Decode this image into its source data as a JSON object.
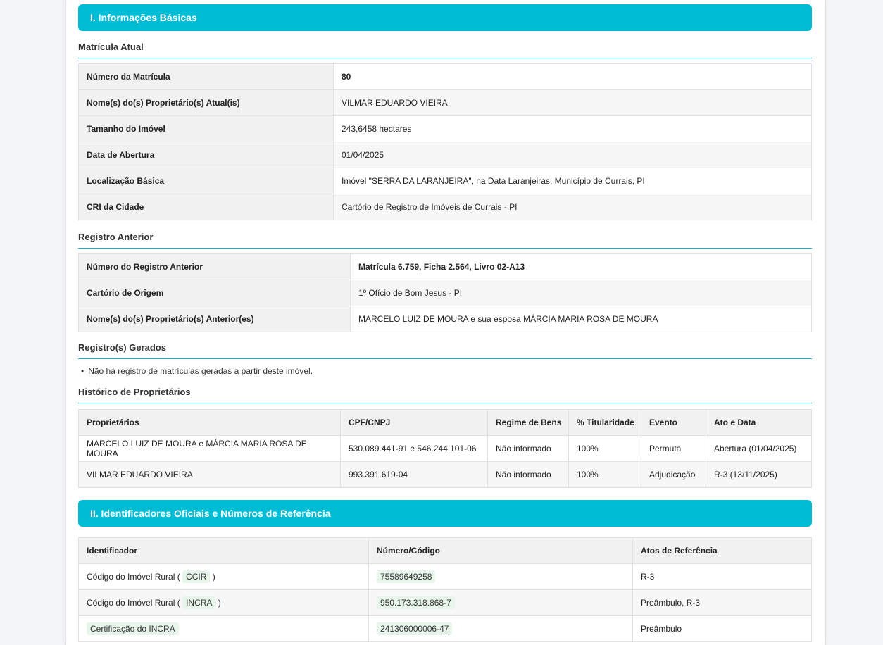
{
  "section1": {
    "title": "I. Informações Básicas",
    "matricula_atual": {
      "heading": "Matrícula Atual",
      "rows": [
        {
          "label": "Número da Matrícula",
          "value": "80"
        },
        {
          "label": "Nome(s) do(s) Proprietário(s) Atual(is)",
          "value": "VILMAR EDUARDO VIEIRA"
        },
        {
          "label": "Tamanho do Imóvel",
          "value": "243,6458 hectares"
        },
        {
          "label": "Data de Abertura",
          "value": "01/04/2025"
        },
        {
          "label": "Localização Básica",
          "value": "Imóvel \"SERRA DA LARANJEIRA\", na Data Laranjeiras, Município de Currais, PI"
        },
        {
          "label": "CRI da Cidade",
          "value": "Cartório de Registro de Imóveis de Currais - PI"
        }
      ]
    },
    "registro_anterior": {
      "heading": "Registro Anterior",
      "rows": [
        {
          "label": "Número do Registro Anterior",
          "value": "Matrícula 6.759, Ficha 2.564, Livro 02-A13"
        },
        {
          "label": "Cartório de Origem",
          "value": "1º Ofício de Bom Jesus - PI"
        },
        {
          "label": "Nome(s) do(s) Proprietário(s) Anterior(es)",
          "value": "MARCELO LUIZ DE MOURA e sua esposa MÁRCIA MARIA ROSA DE MOURA"
        }
      ]
    },
    "registros_gerados": {
      "heading": "Registro(s) Gerados",
      "item": "Não há registro de matrículas geradas a partir deste imóvel."
    },
    "historico": {
      "heading": "Histórico de Proprietários",
      "columns": [
        "Proprietários",
        "CPF/CNPJ",
        "Regime de Bens",
        "% Titularidade",
        "Evento",
        "Ato e Data"
      ],
      "rows": [
        [
          "MARCELO LUIZ DE MOURA e MÁRCIA MARIA ROSA DE MOURA",
          "530.089.441-91 e 546.244.101-06",
          "Não informado",
          "100%",
          "Permuta",
          "Abertura (01/04/2025)"
        ],
        [
          "VILMAR EDUARDO VIEIRA",
          "993.391.619-04",
          "Não informado",
          "100%",
          "Adjudicação",
          "R-3 (13/11/2025)"
        ]
      ]
    }
  },
  "section2": {
    "title": "II. Identificadores Oficiais e Números de Referência",
    "columns": [
      "Identificador",
      "Número/Código",
      "Atos de Referência"
    ],
    "rows": [
      {
        "prefix": "Código do Imóvel Rural (",
        "tag": "CCIR",
        "suffix": ")",
        "code": "75589649258",
        "ref": "R-3"
      },
      {
        "prefix": "Código do Imóvel Rural (",
        "tag": "INCRA",
        "suffix": ")",
        "code": "950.173.318.868-7",
        "ref": "Preâmbulo, R-3"
      },
      {
        "prefix": "",
        "tag": "Certificação do INCRA",
        "suffix": "",
        "code": "241306000006-47",
        "ref": "Preâmbulo"
      }
    ]
  },
  "colors": {
    "accent": "#00bcd4",
    "tag_bg": "#e7f5ea",
    "header_bg": "#f1f1f1"
  }
}
